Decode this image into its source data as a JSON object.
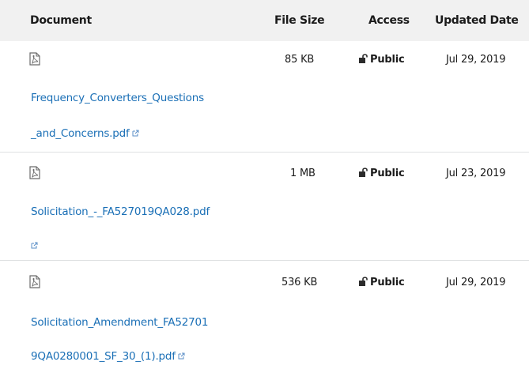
{
  "header": {
    "document": "Document",
    "file_size": "File Size",
    "access": "Access",
    "updated_date": "Updated Date"
  },
  "rows": [
    {
      "file_name_line1": "Frequency_Converters_Questions",
      "file_name_line2": "_and_Concerns.pdf",
      "file_size": "85 KB",
      "access": "Public",
      "updated_date": "Jul 29, 2019"
    },
    {
      "file_name_line1": "Solicitation_-_FA527019QA028.pdf",
      "file_name_line2": "",
      "file_size": "1 MB",
      "access": "Public",
      "updated_date": "Jul 23, 2019"
    },
    {
      "file_name_line1": "Solicitation_Amendment_FA52701",
      "file_name_line2": "9QA0280001_SF_30_(1).pdf",
      "file_size": "536 KB",
      "access": "Public",
      "updated_date": "Jul 29, 2019"
    }
  ],
  "colors": {
    "header_bg": "#f1f1f1",
    "link": "#1a6fb6",
    "border": "#dfe1e2"
  },
  "icons": [
    "pdf-document-icon",
    "external-link-icon",
    "unlocked-icon"
  ]
}
